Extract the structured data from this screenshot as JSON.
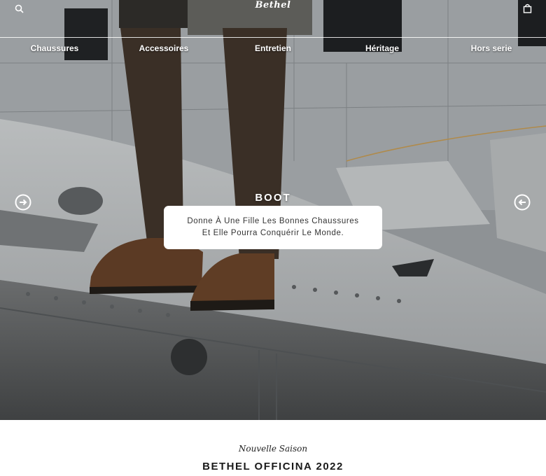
{
  "header": {
    "logo": "Bethel",
    "search_icon": "search-icon",
    "cart_icon": "shopping-bag-icon"
  },
  "nav": {
    "items": [
      {
        "label": "Chaussures"
      },
      {
        "label": "Accessoires"
      },
      {
        "label": "Entretien"
      },
      {
        "label": "Héritage"
      },
      {
        "label": "Hors serie"
      }
    ]
  },
  "hero": {
    "title": "BOOT",
    "tagline_line1": "Donne À Une Fille Les Bonnes Chaussures",
    "tagline_line2": "Et Elle Pourra Conquérir Le Monde.",
    "prev_icon": "arrow-left-circle-icon",
    "next_icon": "arrow-right-circle-icon"
  },
  "section": {
    "subtitle": "Nouvelle Saison",
    "title": "BETHEL OFFICINA 2022"
  },
  "colors": {
    "overlay_text": "#ffffff",
    "card_background": "#ffffff",
    "body_text": "#1a1a1a"
  }
}
